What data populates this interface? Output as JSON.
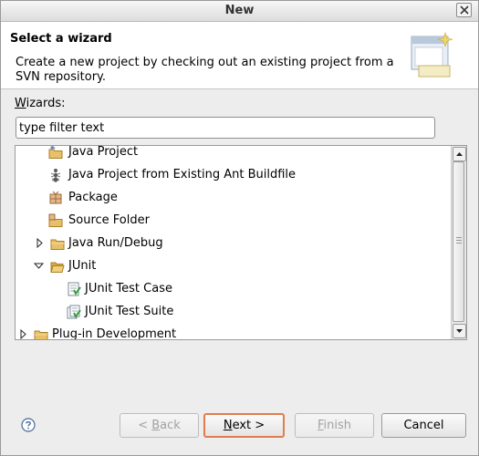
{
  "window": {
    "title": "New"
  },
  "header": {
    "title": "Select a wizard",
    "description": "Create a new project by checking out an existing project from a SVN repository."
  },
  "wizards": {
    "label_mnemonic": "W",
    "label_rest": "izards:",
    "filter_value": "type filter text"
  },
  "tree": {
    "items": [
      {
        "label": "Java Project",
        "icon": "java-project-icon"
      },
      {
        "label": "Java Project from Existing Ant Buildfile",
        "icon": "ant-icon"
      },
      {
        "label": "Package",
        "icon": "package-icon"
      },
      {
        "label": "Source Folder",
        "icon": "source-folder-icon"
      },
      {
        "label": "Java Run/Debug",
        "icon": "folder-icon",
        "expander": "collapsed"
      },
      {
        "label": "JUnit",
        "icon": "folder-icon",
        "expander": "expanded"
      },
      {
        "label": "JUnit Test Case",
        "icon": "junit-test-case-icon"
      },
      {
        "label": "JUnit Test Suite",
        "icon": "junit-test-suite-icon"
      },
      {
        "label": "Plug-in Development",
        "icon": "folder-icon",
        "expander": "collapsed"
      }
    ]
  },
  "buttons": {
    "back": {
      "prefix": "< ",
      "mnemonic": "B",
      "rest": "ack"
    },
    "next": {
      "mnemonic": "N",
      "rest": "ext >"
    },
    "finish": {
      "mnemonic": "F",
      "rest": "inish"
    },
    "cancel": "Cancel"
  },
  "colors": {
    "default_button_border": "#e07c4f",
    "folder": "#e9c06a",
    "junit_green": "#3c9c3c"
  }
}
